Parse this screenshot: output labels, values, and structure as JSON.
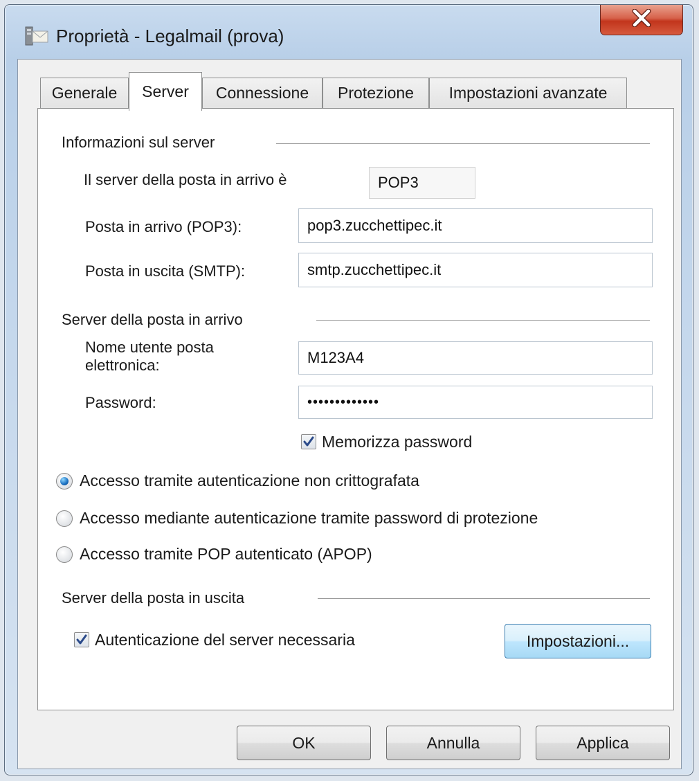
{
  "window": {
    "title": "Proprietà - Legalmail (prova)"
  },
  "tabs": [
    {
      "label": "Generale"
    },
    {
      "label": "Server"
    },
    {
      "label": "Connessione"
    },
    {
      "label": "Protezione"
    },
    {
      "label": "Impostazioni avanzate"
    }
  ],
  "active_tab": "Server",
  "server_info": {
    "heading": "Informazioni sul server",
    "incoming_type_label": "Il server della posta in arrivo è",
    "incoming_type_value": "POP3",
    "incoming_label": "Posta in arrivo (POP3):",
    "incoming_value": "pop3.zucchettipec.it",
    "outgoing_label": "Posta in uscita (SMTP):",
    "outgoing_value": "smtp.zucchettipec.it"
  },
  "incoming_server": {
    "heading": "Server della posta in arrivo",
    "username_label_line1": "Nome utente posta",
    "username_label_line2": "elettronica:",
    "username_value": "M123A4",
    "password_label": "Password:",
    "password_value": "•••••••••••••",
    "remember_password_label": "Memorizza password",
    "remember_password_checked": true
  },
  "auth_options": [
    {
      "label": "Accesso tramite autenticazione non crittografata",
      "selected": true
    },
    {
      "label": "Accesso mediante autenticazione tramite password di protezione",
      "selected": false
    },
    {
      "label": "Accesso tramite POP autenticato (APOP)",
      "selected": false
    }
  ],
  "outgoing_server": {
    "heading": "Server della posta in uscita",
    "auth_required_label": "Autenticazione del server necessaria",
    "auth_required_checked": true,
    "settings_button": "Impostazioni..."
  },
  "buttons": {
    "ok": "OK",
    "cancel": "Annulla",
    "apply": "Applica"
  }
}
